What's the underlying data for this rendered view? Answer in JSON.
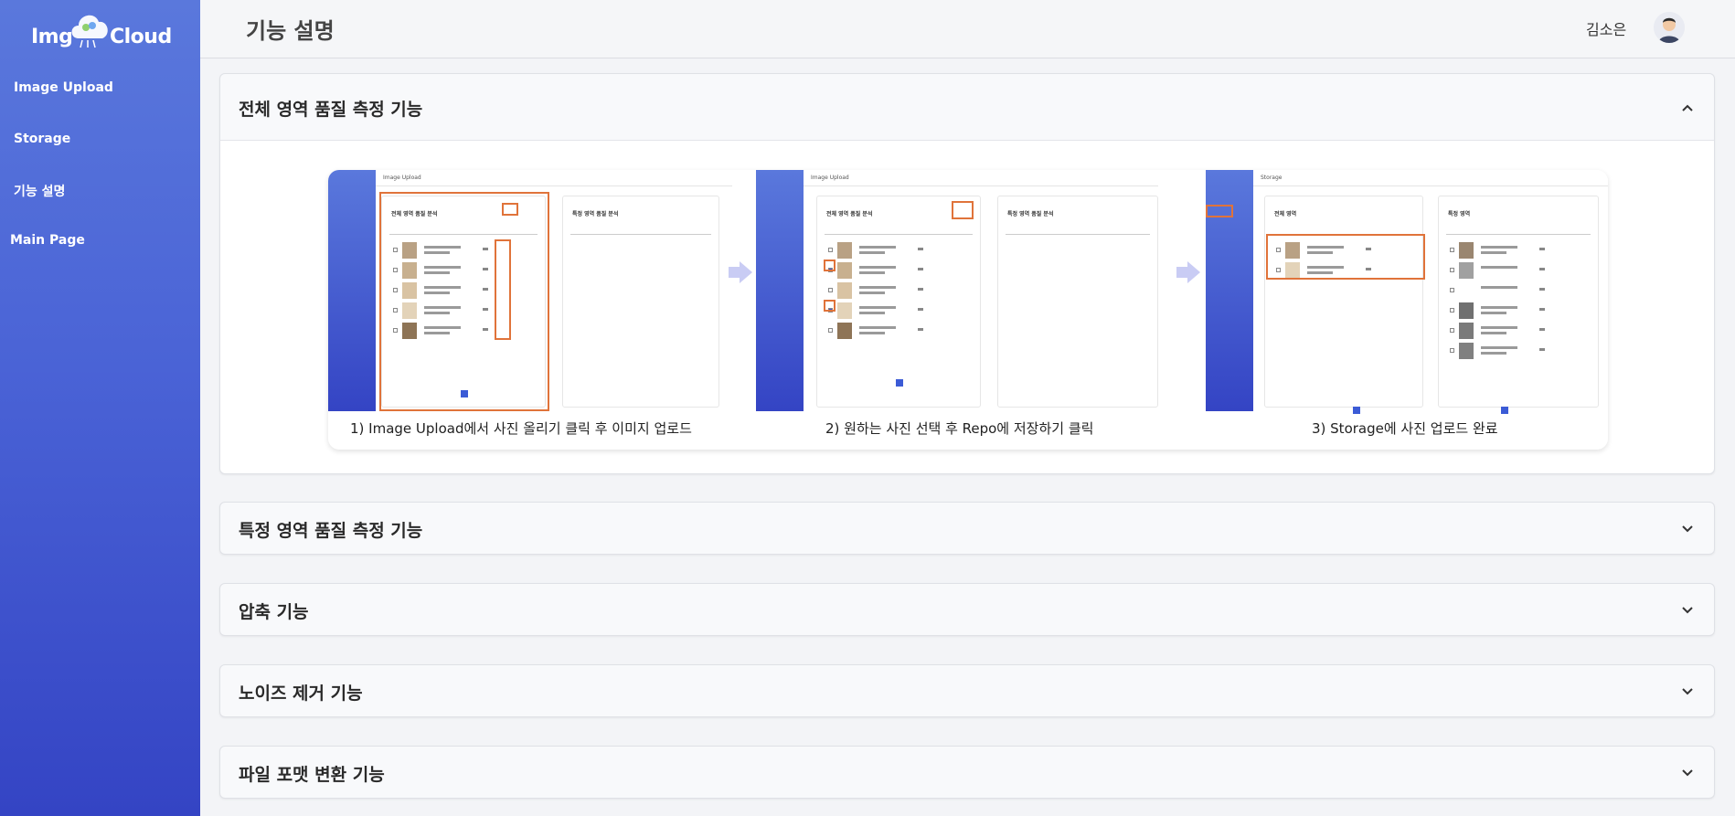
{
  "brand": {
    "left": "Img",
    "right": "Cloud"
  },
  "sidebar": {
    "items": [
      {
        "label": "Image Upload"
      },
      {
        "label": "Storage"
      },
      {
        "label": "기능 설명"
      },
      {
        "label": "Main Page"
      }
    ]
  },
  "header": {
    "title": "기능 설명",
    "user_name": "김소은"
  },
  "sections": [
    {
      "title": "전체 영역 품질 측정 기능",
      "expanded": true
    },
    {
      "title": "특정 영역 품질 측정 기능",
      "expanded": false
    },
    {
      "title": "압축 기능",
      "expanded": false
    },
    {
      "title": "노이즈 제거 기능",
      "expanded": false
    },
    {
      "title": "파일 포맷 변환 기능",
      "expanded": false
    }
  ],
  "guide": {
    "captions": [
      "1) Image Upload에서 사진 올리기 클릭 후 이미지 업로드",
      "2) 원하는 사진 선택 후 Repo에 저장하기 클릭",
      "3) Storage에 사진 업로드 완료"
    ],
    "shots": [
      {
        "page": "Image Upload",
        "left_card": "전체 영역 품질 분석",
        "right_card": "특정 영역 품질 분석"
      },
      {
        "page": "Image Upload",
        "left_card": "전체 영역 품질 분석",
        "right_card": "특정 영역 품질 분석"
      },
      {
        "page": "Storage",
        "left_card": "전체 영역",
        "right_card": "특정 영역"
      }
    ]
  },
  "colors": {
    "sidebar_top": "#5a78dc",
    "sidebar_bottom": "#3444c4",
    "highlight": "#e0733a",
    "accent": "#3b5bd6"
  }
}
